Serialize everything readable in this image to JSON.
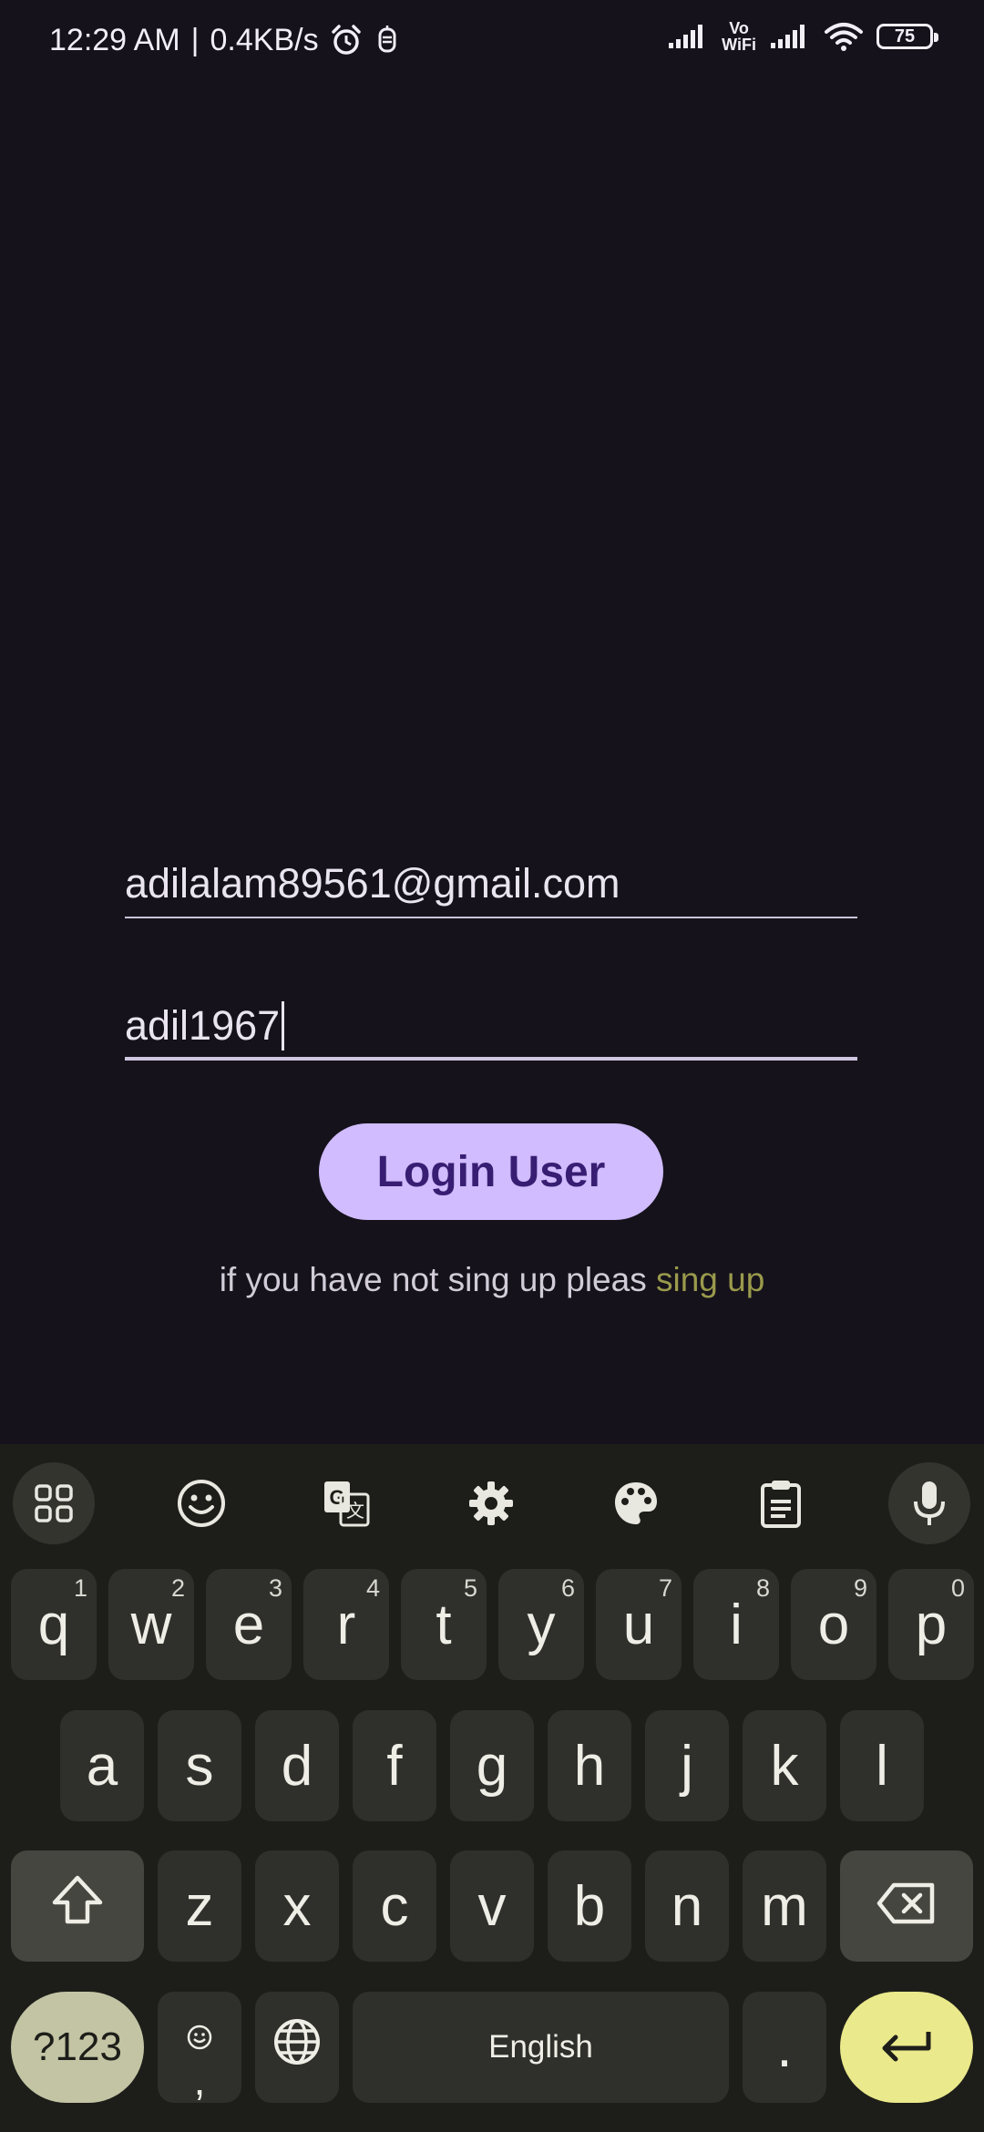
{
  "status_bar": {
    "time": "12:29 AM",
    "separator": "|",
    "speed": "0.4KB/s",
    "vowifi_top": "Vo",
    "vowifi_bottom": "WiFi",
    "battery": "75"
  },
  "form": {
    "email_value": "adilalam89561@gmail.com",
    "password_value": "adil1967",
    "login_label": "Login User",
    "signup_prompt": "if you have not sing up pleas",
    "signup_link": "sing up"
  },
  "keyboard": {
    "toolbar_icons": [
      "apps-grid-icon",
      "emoji-icon",
      "translate-icon",
      "settings-icon",
      "palette-icon",
      "clipboard-icon",
      "microphone-icon"
    ],
    "row1": [
      {
        "key": "q",
        "hint": "1"
      },
      {
        "key": "w",
        "hint": "2"
      },
      {
        "key": "e",
        "hint": "3"
      },
      {
        "key": "r",
        "hint": "4"
      },
      {
        "key": "t",
        "hint": "5"
      },
      {
        "key": "y",
        "hint": "6"
      },
      {
        "key": "u",
        "hint": "7"
      },
      {
        "key": "i",
        "hint": "8"
      },
      {
        "key": "o",
        "hint": "9"
      },
      {
        "key": "p",
        "hint": "0"
      }
    ],
    "row2": [
      "a",
      "s",
      "d",
      "f",
      "g",
      "h",
      "j",
      "k",
      "l"
    ],
    "row3": [
      "z",
      "x",
      "c",
      "v",
      "b",
      "n",
      "m"
    ],
    "symbols_label": "?123",
    "comma_label": ",",
    "space_label": "English",
    "period_label": ".",
    "colors": {
      "key_bg": "#2f302b",
      "modifier_bg": "#45463f",
      "symbols_bg": "#c3c4a4",
      "enter_bg": "#eae98b",
      "keyboard_bg": "#1d1e19"
    }
  },
  "colors": {
    "background": "#15121b",
    "button_bg": "#d0bcff",
    "button_text": "#381e72",
    "link": "#9a9a4c"
  }
}
